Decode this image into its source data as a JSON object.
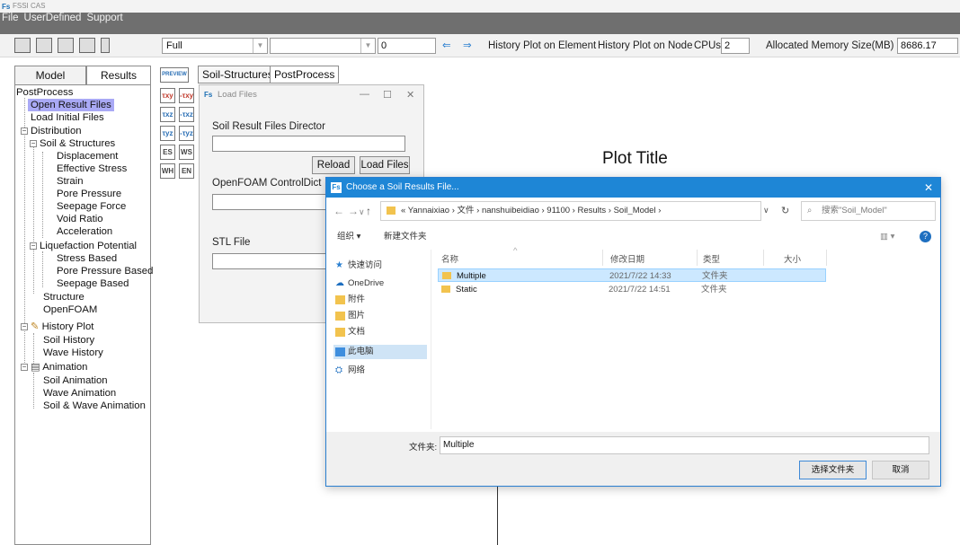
{
  "window": {
    "title": "FSSI CAS"
  },
  "menu": {
    "items": [
      "File",
      "UserDefined",
      "Support"
    ]
  },
  "toolbar": {
    "mode_combo": "Full",
    "number_input": "0",
    "history_element": "History Plot on Element",
    "history_node": "History Plot on Node",
    "cpus_label": "CPUs",
    "cpus_value": "2",
    "memory_label": "Allocated Memory Size(MB) :",
    "memory_value": "8686.17"
  },
  "left_tabs": {
    "model": "Model",
    "results": "Results"
  },
  "tree": {
    "root": "PostProcess",
    "open_result_files": "Open Result Files",
    "load_initial_files": "Load Initial Files",
    "distribution": "Distribution",
    "soil_structures": "Soil & Structures",
    "displacement": "Displacement",
    "effective_stress": "Effective Stress",
    "strain": "Strain",
    "pore_pressure": "Pore Pressure",
    "seepage_force": "Seepage Force",
    "void_ratio": "Void Ratio",
    "acceleration": "Acceleration",
    "liquefaction_potential": "Liquefaction Potential",
    "stress_based": "Stress Based",
    "pore_pressure_based": "Pore Pressure Based",
    "seepage_based": "Seepage Based",
    "structure": "Structure",
    "openfoam": "OpenFOAM",
    "history_plot": "History Plot",
    "soil_history": "Soil History",
    "wave_history": "Wave History",
    "animation": "Animation",
    "soil_animation": "Soil Animation",
    "wave_animation": "Wave Animation",
    "soil_wave_animation": "Soil & Wave Animation"
  },
  "palette_icons": [
    "τxy",
    "-τxy",
    "τxz",
    "-τxz",
    "τyz",
    "-τyz",
    "ES",
    "WS",
    "WH",
    "EN"
  ],
  "right_tabs": {
    "soil_structures": "Soil-Structures",
    "postprocess": "PostProcess"
  },
  "plot": {
    "title": "Plot Title"
  },
  "load_files": {
    "title": "Load Files",
    "soil_result_label": "Soil Result Files Director",
    "reload": "Reload",
    "load_files": "Load Files",
    "openfoam_label": "OpenFOAM ControlDict",
    "stl_label": "STL File"
  },
  "choose": {
    "title": "Choose a Soil Results File...",
    "path": "« Yannaixiao › 文件 › nanshuibeidiao › 91100 › Results › Soil_Model ›",
    "search_placeholder": "搜索\"Soil_Model\"",
    "organize": "组织 ▾",
    "new_folder": "新建文件夹",
    "nav": [
      "快速访问",
      "OneDrive",
      "附件",
      "图片",
      "文档",
      "此电脑",
      "网络"
    ],
    "columns": [
      "名称",
      "修改日期",
      "类型",
      "大小"
    ],
    "rows": [
      {
        "name": "Multiple",
        "date": "2021/7/22 14:33",
        "type": "文件夹"
      },
      {
        "name": "Static",
        "date": "2021/7/22 14:51",
        "type": "文件夹"
      }
    ],
    "folder_label": "文件夹:",
    "folder_value": "Multiple",
    "select_button": "选择文件夹",
    "cancel_button": "取消"
  }
}
